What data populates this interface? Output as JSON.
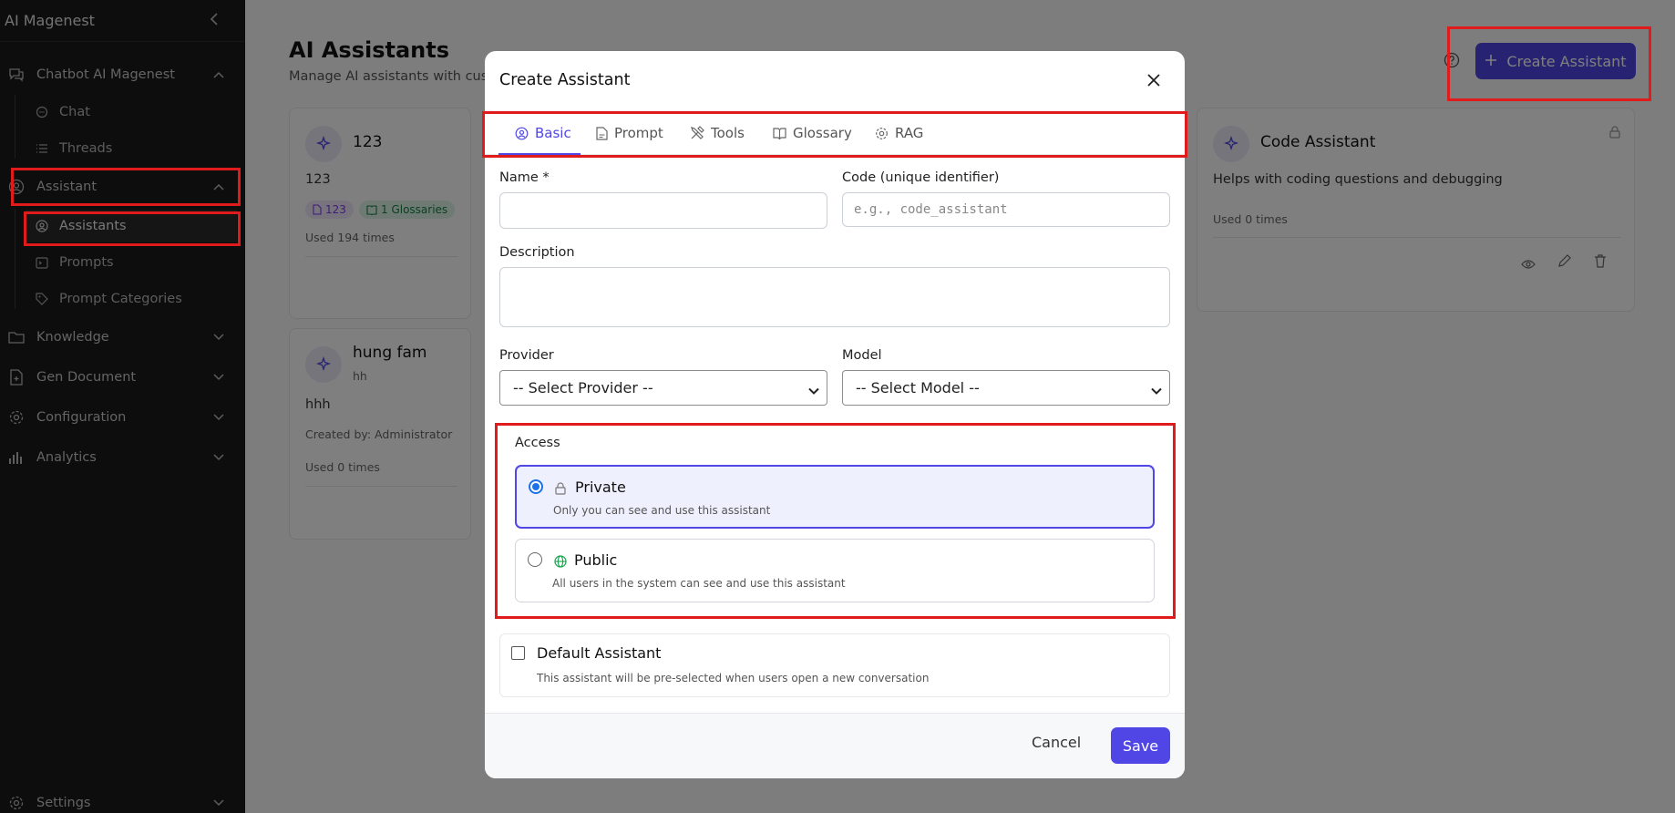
{
  "sidebar": {
    "brand": "AI Magenest",
    "groups": [
      {
        "label": "Chatbot AI Magenest",
        "items": [
          "Chat",
          "Threads"
        ]
      },
      {
        "label": "Assistant",
        "items": [
          "Assistants",
          "Prompts",
          "Prompt Categories"
        ]
      },
      {
        "label": "Knowledge"
      },
      {
        "label": "Gen Document"
      },
      {
        "label": "Configuration"
      },
      {
        "label": "Analytics"
      }
    ],
    "settings_label": "Settings"
  },
  "page": {
    "title": "AI Assistants",
    "subtitle": "Manage AI assistants with custom",
    "create_label": "Create Assistant"
  },
  "cards": [
    {
      "title": "123",
      "desc": "123",
      "chip_prompt": "123",
      "chip_glossary": "1 Glossaries",
      "usage": "Used 194 times"
    },
    {
      "title": "hung fam",
      "subtitle": "hh",
      "desc": "hhh",
      "creator": "Created by: Administrator",
      "usage": "Used 0 times"
    },
    {
      "title": "Code Assistant",
      "desc": "Helps with coding questions and debugging",
      "usage": "Used 0 times"
    }
  ],
  "modal": {
    "title": "Create Assistant",
    "tabs": [
      "Basic",
      "Prompt",
      "Tools",
      "Glossary",
      "RAG"
    ],
    "name_label": "Name *",
    "name_value": "",
    "code_label": "Code (unique identifier)",
    "code_placeholder": "e.g., code_assistant",
    "description_label": "Description",
    "description_value": "",
    "provider_label": "Provider",
    "provider_value": "-- Select Provider --",
    "model_label": "Model",
    "model_value": "-- Select Model --",
    "access_label": "Access",
    "access_options": [
      {
        "title": "Private",
        "desc": "Only you can see and use this assistant",
        "selected": true
      },
      {
        "title": "Public",
        "desc": "All users in the system can see and use this assistant",
        "selected": false
      }
    ],
    "default_title": "Default Assistant",
    "default_desc": "This assistant will be pre-selected when users open a new conversation",
    "default_checked": false,
    "cancel_label": "Cancel",
    "save_label": "Save"
  },
  "colors": {
    "accent": "#4f46e5",
    "highlight": "#e01b1b",
    "sidebar_bg": "#1a1a1a"
  }
}
